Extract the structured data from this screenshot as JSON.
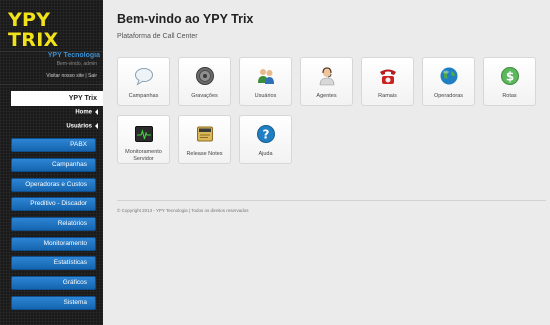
{
  "sidebar": {
    "logo_title": "YPY TRIX",
    "logo_subtitle": "YPY Tecnologia",
    "welcome_text": "Bem-vindo, admin",
    "visit_link": "Visitar nosso site",
    "link_separator": "|",
    "logout_link": "Sair",
    "active_section": "YPY Trix",
    "subnav": [
      "Home",
      "Usuários"
    ],
    "menu": [
      "PABX",
      "Campanhas",
      "Operadoras e Custos",
      "Preditivo - Discador",
      "Relatórios",
      "Monitoramento",
      "Estatísticas",
      "Gráficos",
      "Sistema"
    ]
  },
  "main": {
    "title": "Bem-vindo ao YPY Trix",
    "subtitle": "Plataforma de Call Center",
    "tiles": [
      {
        "label": "Campanhas",
        "icon": "speech-bubble-icon"
      },
      {
        "label": "Gravações",
        "icon": "speaker-icon"
      },
      {
        "label": "Usuários",
        "icon": "users-icon"
      },
      {
        "label": "Agentes",
        "icon": "agent-headset-icon"
      },
      {
        "label": "Ramais",
        "icon": "telephone-icon"
      },
      {
        "label": "Operadoras",
        "icon": "globe-icon"
      },
      {
        "label": "Rotas",
        "icon": "dollar-coin-icon"
      },
      {
        "label": "Monitoramento Servidor",
        "icon": "heartbeat-monitor-icon"
      },
      {
        "label": "Release Notes",
        "icon": "notes-icon"
      },
      {
        "label": "Ajuda",
        "icon": "help-icon"
      }
    ],
    "footer": "© Copyright 2013 - YPY Tecnologia | Todos os direitos reservados"
  },
  "colors": {
    "logo_yellow": "#f2e21a",
    "accent_blue": "#1c73c4",
    "sidebar_bg": "#1a1a1a",
    "main_bg": "#ebebeb"
  }
}
